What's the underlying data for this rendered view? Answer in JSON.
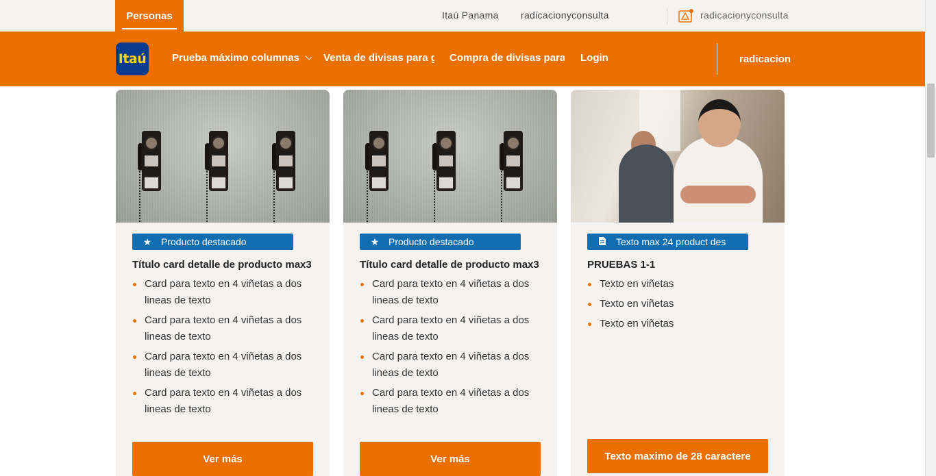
{
  "topbar": {
    "active_tab": "Personas",
    "links": [
      "Itaú Panama",
      "radicacionyconsulta"
    ],
    "notification_icon": "alert-bell-icon",
    "user_label": "radicacionyconsulta"
  },
  "navbar": {
    "logo_text": "Itaú",
    "items": [
      "Prueba máximo columnas",
      "Venta de divisas para gi",
      "Compra de divisas para r",
      "Login"
    ],
    "user_label": "radicacion",
    "colors": {
      "brand_orange": "#ec7000",
      "logo_blue": "#0b3b8c",
      "badge_blue": "#106eb0"
    }
  },
  "cards": [
    {
      "badge": "Producto destacado",
      "badge_icon": "star-icon",
      "title": "Título card detalle de producto max3",
      "bullets": [
        "Card para texto en 4 viñetas a dos lineas de texto",
        "Card para texto en 4 viñetas a dos lineas de texto",
        "Card para texto en 4 viñetas a dos lineas de texto",
        "Card para texto en 4 viñetas a dos lineas de texto"
      ],
      "cta": "Ver más"
    },
    {
      "badge": "Producto destacado",
      "badge_icon": "star-icon",
      "title": "Título card detalle de producto max3",
      "bullets": [
        "Card para texto en 4 viñetas a dos lineas de texto",
        "Card para texto en 4 viñetas a dos lineas de texto",
        "Card para texto en 4 viñetas a dos lineas de texto",
        "Card para texto en 4 viñetas a dos lineas de texto"
      ],
      "cta": "Ver más"
    },
    {
      "badge": "Texto max 24 product des",
      "badge_icon": "document-icon",
      "title": "PRUEBAS 1-1",
      "bullets": [
        "Texto en viñetas",
        "Texto en viñetas",
        "Texto en viñetas"
      ],
      "cta": "Texto maximo de 28 caractere"
    }
  ]
}
